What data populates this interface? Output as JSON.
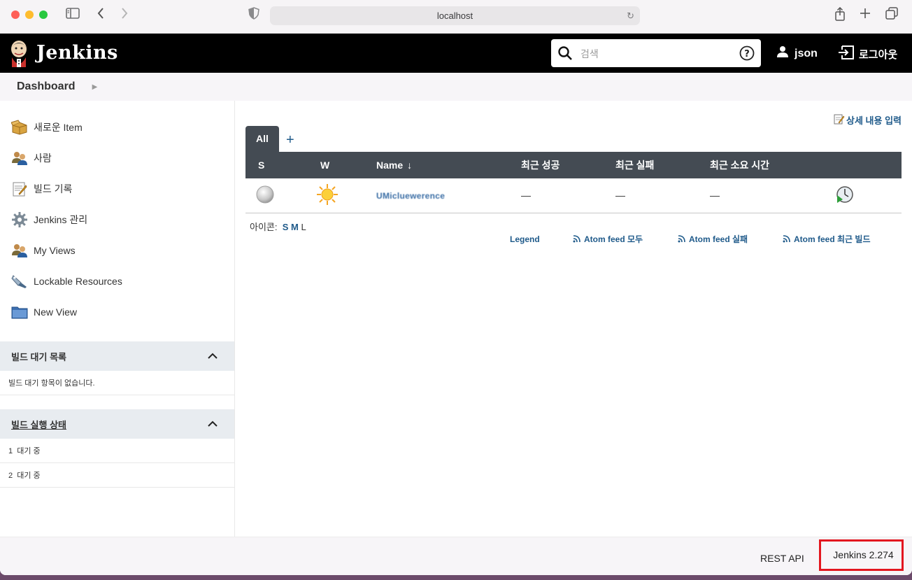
{
  "browser": {
    "url": "localhost"
  },
  "header": {
    "brand": "Jenkins",
    "search_placeholder": "검색",
    "username": "json",
    "logout": "로그아웃"
  },
  "breadcrumb": {
    "home": "Dashboard"
  },
  "sidebar": {
    "items": [
      {
        "label": "새로운 Item",
        "icon": "new-item-icon"
      },
      {
        "label": "사람",
        "icon": "people-icon"
      },
      {
        "label": "빌드 기록",
        "icon": "build-history-icon"
      },
      {
        "label": "Jenkins 관리",
        "icon": "gear-icon"
      },
      {
        "label": "My Views",
        "icon": "people-icon"
      },
      {
        "label": "Lockable Resources",
        "icon": "lock-resources-icon"
      },
      {
        "label": "New View",
        "icon": "folder-icon"
      }
    ]
  },
  "build_queue": {
    "title": "빌드 대기 목록",
    "empty": "빌드 대기 항목이 없습니다."
  },
  "executors": {
    "title": "빌드 실행 상태",
    "rows": [
      "1  대기 중",
      "2  대기 중"
    ]
  },
  "main": {
    "edit_description": "상세 내용 입력",
    "tab_all": "All",
    "tab_add": "+",
    "columns": [
      "S",
      "W",
      "Name",
      "최근 성공",
      "최근 실패",
      "최근 소요 시간"
    ],
    "sort_arrow": "↓",
    "jobs": [
      {
        "status": "not-built",
        "weather": "sunny",
        "name": "UMicluewerence",
        "last_success": "—",
        "last_failure": "—",
        "last_duration": "—"
      }
    ],
    "icon_label": "아이콘:",
    "icon_sizes": [
      "S",
      "M",
      "L"
    ],
    "legend": "Legend",
    "feeds": [
      "Atom feed 모두",
      "Atom feed 실패",
      "Atom feed 최근 빌드"
    ]
  },
  "footer": {
    "rest_api": "REST API",
    "version": "Jenkins 2.274"
  },
  "colors": {
    "header_bg": "#000000",
    "table_header": "#444b53",
    "link": "#1f5a8a",
    "highlight_box": "#e3161f"
  }
}
